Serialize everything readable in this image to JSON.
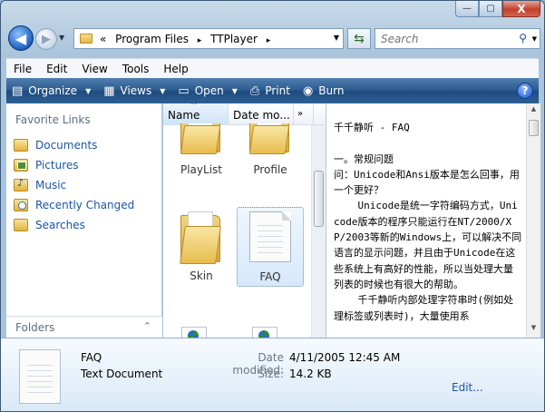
{
  "window": {
    "controls": {
      "minimize": "—",
      "maximize": "▢",
      "close": "X"
    }
  },
  "navigation": {
    "back_glyph": "◀",
    "forward_glyph": "▶",
    "breadcrumb": {
      "prefix": "«",
      "segments": [
        "Program Files",
        "TTPlayer"
      ],
      "separator": "▸"
    },
    "refresh_glyph": "⇆",
    "search_placeholder": "Search",
    "search_glyph": "⚲"
  },
  "menubar": {
    "items": [
      "File",
      "Edit",
      "View",
      "Tools",
      "Help"
    ]
  },
  "toolbar": {
    "items": [
      {
        "label": "Organize",
        "icon": "organize-icon",
        "has_dropdown": true
      },
      {
        "label": "Views",
        "icon": "views-icon",
        "has_dropdown": true
      },
      {
        "label": "Open",
        "icon": "open-icon",
        "has_dropdown": true
      },
      {
        "label": "Print",
        "icon": "printer-icon",
        "has_dropdown": false
      },
      {
        "label": "Burn",
        "icon": "burn-disc-icon",
        "has_dropdown": false
      }
    ],
    "help_label": "?"
  },
  "nav_pane": {
    "favorites_title": "Favorite Links",
    "favorites": [
      "Documents",
      "Pictures",
      "Music",
      "Recently Changed",
      "Searches"
    ],
    "folders_label": "Folders",
    "folders_chevron": "⌃"
  },
  "file_pane": {
    "columns": [
      "Name",
      "Date mo...",
      "»"
    ],
    "items": [
      {
        "name": "PlayList",
        "type": "folder"
      },
      {
        "name": "Profile",
        "type": "folder"
      },
      {
        "name": "Skin",
        "type": "folder"
      },
      {
        "name": "FAQ",
        "type": "text-document",
        "selected": true
      }
    ]
  },
  "preview": {
    "text": "千千静听 - FAQ\n\n一。常规问题\n问：Unicode和Ansi版本是怎么回事，用一个更好？\n    Unicode是统一字符编码方式，Unicode版本的程序只能运行在NT/2000/XP/2003等新的Windows上，可以解决不同语言的显示问题，并且由于Unicode在这些系统上有高好的性能，所以当处理大量列表的时候也有很大的帮助。\n    千千静听内部处理字符串时(例如处理标签或列表时)，大量使用系"
  },
  "details": {
    "name": "FAQ",
    "type": "Text Document",
    "date_modified_label": "Date modified:",
    "date_modified": "4/11/2005 12:45 AM",
    "size_label": "Size:",
    "size": "14.2 KB",
    "edit_link": "Edit..."
  },
  "colors": {
    "toolbar_bg": "#2c5a8e",
    "link": "#1b55a5",
    "accent": "#1d5fc0"
  }
}
